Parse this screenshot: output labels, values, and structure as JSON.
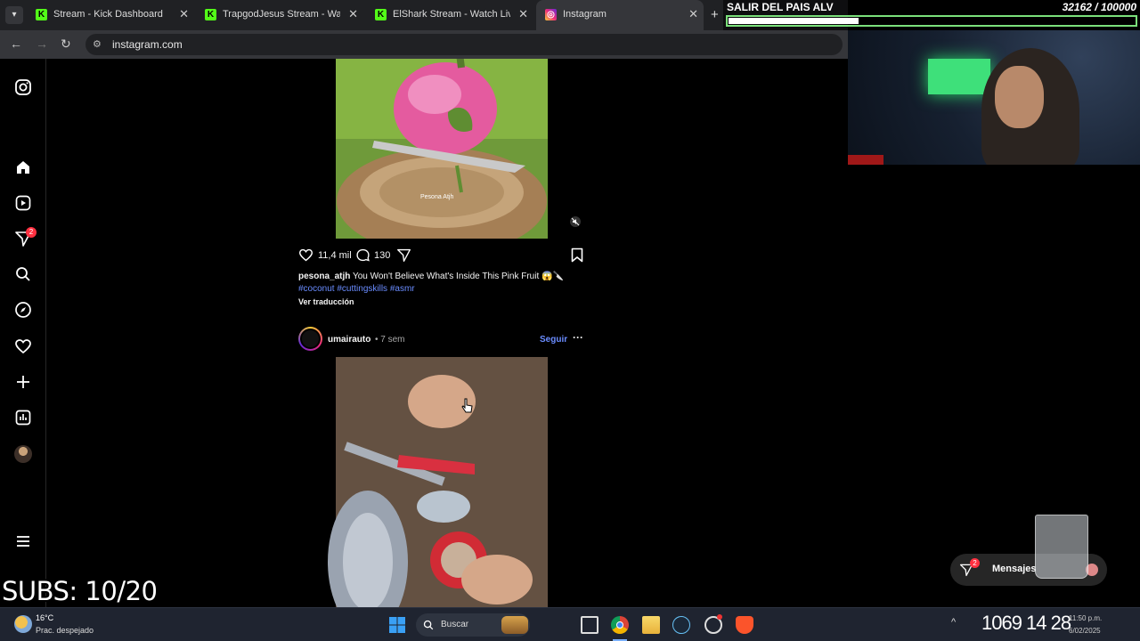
{
  "browser": {
    "tabs": [
      {
        "title": "Stream - Kick Dashboard",
        "favicon": "kick-icon"
      },
      {
        "title": "TrapgodJesus Stream - Watch Live on Kick",
        "favicon": "kick-icon"
      },
      {
        "title": "ElShark Stream - Watch Live on Kick",
        "favicon": "kick-icon"
      },
      {
        "title": "Instagram",
        "favicon": "instagram-icon",
        "active": true
      }
    ],
    "url": "instagram.com"
  },
  "sidebar": {
    "notifications_badge": "2"
  },
  "post1": {
    "likes": "11,4 mil",
    "comments": "130",
    "caption_user": "pesona_atjh",
    "caption_text": " You Won't Believe What's Inside This Pink Fruit 😱🔪",
    "hashtags": "#coconut #cuttingskills #asmr",
    "translate": "Ver traducción",
    "watermark": "Pesona Atjh"
  },
  "post2": {
    "username": "umairauto",
    "time": " • 7 sem",
    "follow": "Seguir"
  },
  "messages": {
    "label": "Mensajes",
    "badge": "2"
  },
  "overlay": {
    "goal_title": "SALIR DEL PAIS ALV",
    "goal_count": "32162 / 100000",
    "goal_progress": 0.32,
    "subs": "SUBS: 10/20"
  },
  "taskbar": {
    "temp": "16°C",
    "weather": "Prac. despejado",
    "search": "Buscar",
    "clock_large": "1069 14 28",
    "time_small": "11:50 p.m.",
    "date_small": "6/02/2025"
  },
  "colors": {
    "accent_link": "#6a8cff",
    "badge_red": "#ff3040",
    "goal_border": "#7be07b",
    "kick_green": "#53fc18"
  }
}
